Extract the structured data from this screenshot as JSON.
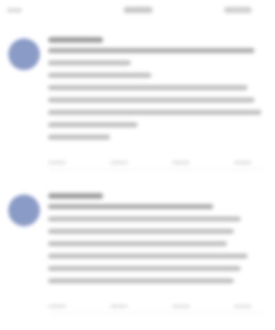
{
  "screen": {
    "state": "blurred"
  },
  "header": {
    "left_item_icon": "back-icon",
    "title": "",
    "right_item_label": ""
  },
  "posts": [
    {
      "author": "",
      "text": "",
      "avatar_color": "#8a9bc6",
      "line_count": 8
    },
    {
      "author": "",
      "text": "",
      "avatar_color": "#8a9bc6",
      "line_count": 7
    }
  ],
  "colors": {
    "background": "#ffffff",
    "avatar": "#8a9bc6",
    "text_placeholder": "#bdbdbd"
  }
}
